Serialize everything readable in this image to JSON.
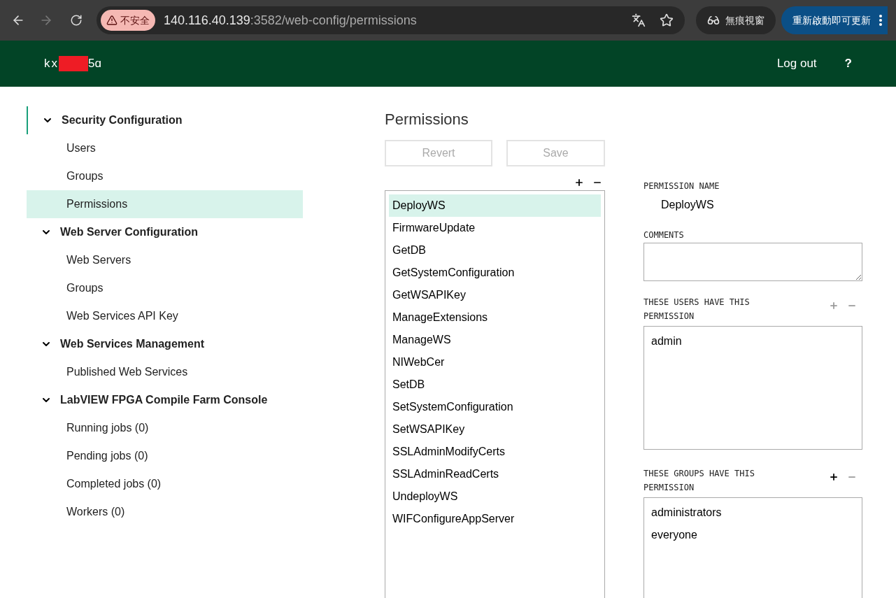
{
  "browser": {
    "security_label": "不安全",
    "url_host": "140.116.40.139",
    "url_rest": ":3582/web-config/permissions",
    "incognito_label": "無痕視窗",
    "update_button": "重新啟動即可更新"
  },
  "header": {
    "brand_start": "kx",
    "brand_end": "5ɑ",
    "logout": "Log out",
    "help": "?"
  },
  "sidebar": [
    {
      "label": "Security Configuration",
      "expanded": true,
      "children": [
        {
          "label": "Users",
          "selected": false
        },
        {
          "label": "Groups",
          "selected": false
        },
        {
          "label": "Permissions",
          "selected": true
        }
      ]
    },
    {
      "label": "Web Server Configuration",
      "expanded": true,
      "children": [
        {
          "label": "Web Servers",
          "selected": false
        },
        {
          "label": "Groups",
          "selected": false
        },
        {
          "label": "Web Services API Key",
          "selected": false
        }
      ]
    },
    {
      "label": "Web Services Management",
      "expanded": true,
      "children": [
        {
          "label": "Published Web Services",
          "selected": false
        }
      ]
    },
    {
      "label": "LabVIEW FPGA Compile Farm Console",
      "expanded": true,
      "children": [
        {
          "label": "Running jobs (0)",
          "selected": false
        },
        {
          "label": "Pending jobs (0)",
          "selected": false
        },
        {
          "label": "Completed jobs (0)",
          "selected": false
        },
        {
          "label": "Workers (0)",
          "selected": false
        }
      ]
    }
  ],
  "main": {
    "title": "Permissions",
    "buttons": [
      {
        "label": "Revert",
        "disabled": true
      },
      {
        "label": "Save",
        "disabled": true
      }
    ],
    "list_actions": {
      "add_disabled": false,
      "remove_disabled": false
    },
    "permissions": [
      {
        "name": "DeployWS",
        "selected": true
      },
      {
        "name": "FirmwareUpdate",
        "selected": false
      },
      {
        "name": "GetDB",
        "selected": false
      },
      {
        "name": "GetSystemConfiguration",
        "selected": false
      },
      {
        "name": "GetWSAPIKey",
        "selected": false
      },
      {
        "name": "ManageExtensions",
        "selected": false
      },
      {
        "name": "ManageWS",
        "selected": false
      },
      {
        "name": "NIWebCer",
        "selected": false
      },
      {
        "name": "SetDB",
        "selected": false
      },
      {
        "name": "SetSystemConfiguration",
        "selected": false
      },
      {
        "name": "SetWSAPIKey",
        "selected": false
      },
      {
        "name": "SSLAdminModifyCerts",
        "selected": false
      },
      {
        "name": "SSLAdminReadCerts",
        "selected": false
      },
      {
        "name": "UndeployWS",
        "selected": false
      },
      {
        "name": "WIFConfigureAppServer",
        "selected": false
      }
    ]
  },
  "details": {
    "name_label": "PERMISSION NAME",
    "name_value": "DeployWS",
    "comments_label": "COMMENTS",
    "users": {
      "label": "THESE USERS HAVE THIS PERMISSION",
      "add_disabled": true,
      "remove_disabled": true,
      "items": [
        "admin"
      ]
    },
    "groups": {
      "label": "THESE GROUPS HAVE THIS PERMISSION",
      "add_disabled": false,
      "remove_disabled": true,
      "items": [
        "administrators",
        "everyone"
      ]
    }
  }
}
